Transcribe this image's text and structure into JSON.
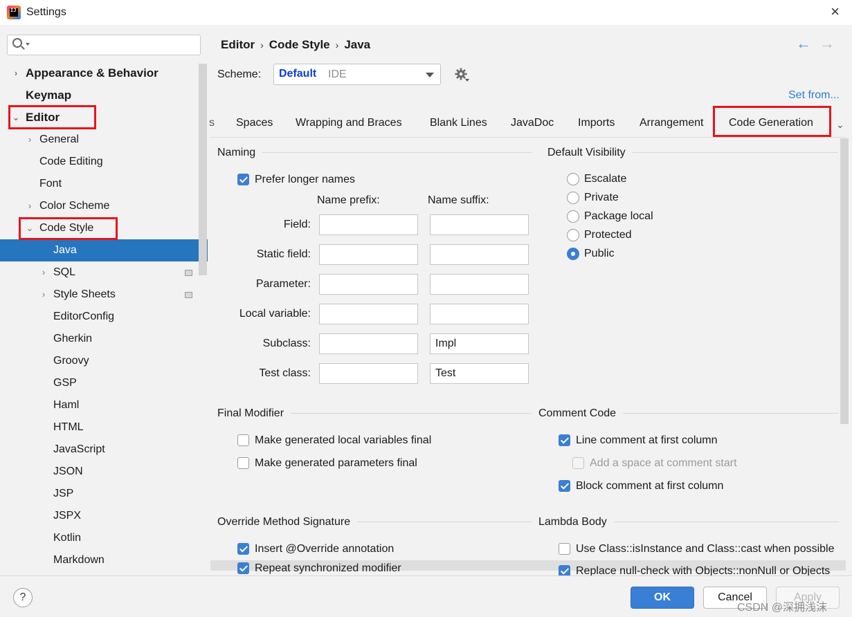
{
  "window": {
    "title": "Settings"
  },
  "search": {
    "placeholder": ""
  },
  "sidebar": {
    "items": [
      {
        "label": "Appearance & Behavior",
        "arrow": "›"
      },
      {
        "label": "Keymap",
        "arrow": ""
      },
      {
        "label": "Editor",
        "arrow": "⌄"
      },
      {
        "label": "General",
        "arrow": "›"
      },
      {
        "label": "Code Editing",
        "arrow": ""
      },
      {
        "label": "Font",
        "arrow": ""
      },
      {
        "label": "Color Scheme",
        "arrow": "›"
      },
      {
        "label": "Code Style",
        "arrow": "⌄"
      },
      {
        "label": "Java",
        "arrow": ""
      },
      {
        "label": "SQL",
        "arrow": "›"
      },
      {
        "label": "Style Sheets",
        "arrow": "›"
      },
      {
        "label": "EditorConfig",
        "arrow": ""
      },
      {
        "label": "Gherkin",
        "arrow": ""
      },
      {
        "label": "Groovy",
        "arrow": ""
      },
      {
        "label": "GSP",
        "arrow": ""
      },
      {
        "label": "Haml",
        "arrow": ""
      },
      {
        "label": "HTML",
        "arrow": ""
      },
      {
        "label": "JavaScript",
        "arrow": ""
      },
      {
        "label": "JSON",
        "arrow": ""
      },
      {
        "label": "JSP",
        "arrow": ""
      },
      {
        "label": "JSPX",
        "arrow": ""
      },
      {
        "label": "Kotlin",
        "arrow": ""
      },
      {
        "label": "Markdown",
        "arrow": ""
      }
    ]
  },
  "breadcrumb": {
    "part1": "Editor",
    "part2": "Code Style",
    "part3": "Java",
    "separator": "›"
  },
  "nav": {
    "back": "←",
    "forward": "→"
  },
  "scheme": {
    "label": "Scheme:",
    "name": "Default",
    "sub": "IDE"
  },
  "set_from": "Set from...",
  "tabs": {
    "items": [
      "s",
      "Spaces",
      "Wrapping and Braces",
      "Blank Lines",
      "JavaDoc",
      "Imports",
      "Arrangement",
      "Code Generation"
    ],
    "active": "Code Generation",
    "more": "⌄"
  },
  "naming": {
    "title": "Naming",
    "prefer_longer": {
      "label": "Prefer longer names",
      "checked": true
    },
    "prefix_header": "Name prefix:",
    "suffix_header": "Name suffix:",
    "rows": [
      {
        "label": "Field:",
        "prefix": "",
        "suffix": ""
      },
      {
        "label": "Static field:",
        "prefix": "",
        "suffix": ""
      },
      {
        "label": "Parameter:",
        "prefix": "",
        "suffix": ""
      },
      {
        "label": "Local variable:",
        "prefix": "",
        "suffix": ""
      },
      {
        "label": "Subclass:",
        "prefix": "",
        "suffix": "Impl"
      },
      {
        "label": "Test class:",
        "prefix": "",
        "suffix": "Test"
      }
    ]
  },
  "visibility": {
    "title": "Default Visibility",
    "options": [
      "Escalate",
      "Private",
      "Package local",
      "Protected",
      "Public"
    ],
    "selected": "Public"
  },
  "final_modifier": {
    "title": "Final Modifier",
    "local_vars": {
      "label": "Make generated local variables final",
      "checked": false
    },
    "params": {
      "label": "Make generated parameters final",
      "checked": false
    }
  },
  "comment_code": {
    "title": "Comment Code",
    "line_first": {
      "label": "Line comment at first column",
      "checked": true
    },
    "add_space": {
      "label": "Add a space at comment start",
      "checked": false
    },
    "block_first": {
      "label": "Block comment at first column",
      "checked": true
    }
  },
  "override": {
    "title": "Override Method Signature",
    "insert": {
      "label": "Insert @Override annotation",
      "checked": true
    },
    "repeat": {
      "label": "Repeat synchronized modifier",
      "checked": true
    }
  },
  "lambda": {
    "title": "Lambda Body",
    "use_class": {
      "label": "Use Class::isInstance and Class::cast when possible",
      "checked": false
    },
    "replace_null": {
      "label": "Replace null-check with Objects::nonNull or Objects",
      "checked": true
    }
  },
  "footer": {
    "help": "?",
    "ok": "OK",
    "cancel": "Cancel",
    "apply": "Apply",
    "watermark": "CSDN @深拥浅沫"
  },
  "colors": {
    "accent": "#2675bf",
    "link": "#2c7fd4",
    "annotation_red": "#e8141c",
    "scheme_name": "#0b3fd6"
  }
}
